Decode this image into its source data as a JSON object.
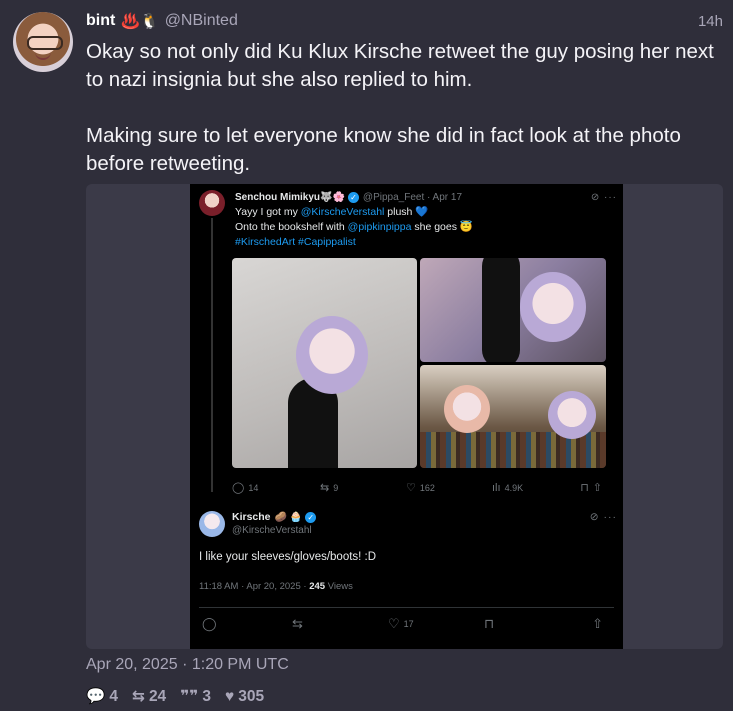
{
  "post": {
    "author_name": "bint",
    "author_emoji": "♨️🐧",
    "author_handle": "@NBinted",
    "time_ago": "14h",
    "paragraphs": [
      "Okay so not only did Ku Klux Kirsche retweet the guy posing her next to nazi insignia but she also replied to him.",
      "Making sure to let everyone know she did in fact look at the photo before retweeting."
    ],
    "date": "Apr 20, 2025 · 1:20 PM UTC",
    "stats": {
      "replies": "4",
      "reposts": "24",
      "quotes": "3",
      "likes": "305"
    }
  },
  "embed": {
    "tweet1": {
      "name": "Senchou Mimikyu🐺🌸",
      "verified": "✓",
      "meta": "@Pippa_Feet · Apr 17",
      "line1_pre": "Yayy I got my ",
      "line1_mention": "@KirscheVerstahl",
      "line1_post": " plush 💙",
      "line2_pre": "Onto the bookshelf with ",
      "line2_mention": "@pipkinpippa",
      "line2_post": " she goes 😇",
      "hashtags": "#KirschedArt #Capippalist",
      "replies": "14",
      "reposts": "9",
      "likes": "162",
      "views": "4.9K"
    },
    "tweet2": {
      "name": "Kirsche",
      "badges": "🥔 🧁",
      "verified": "✓",
      "handle": "@KirscheVerstahl",
      "text": "I like your sleeves/gloves/boots! :D",
      "meta_pre": "11:18 AM · Apr 20, 2025 · ",
      "views_count": "245",
      "views_label": " Views",
      "likes": "17"
    }
  },
  "icons": {
    "reply": "speech-bubble",
    "repost": "repost-arrows",
    "like": "heart",
    "views": "bar-chart",
    "bookmark": "bookmark",
    "share": "share-upload",
    "more": "ellipsis",
    "grok": "grok-slash"
  },
  "colors": {
    "background": "#2f2e3a",
    "link": "#1d9bf0",
    "muted": "#a9a6b8"
  }
}
